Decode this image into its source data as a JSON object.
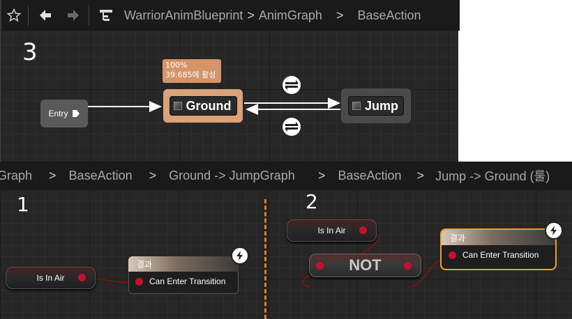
{
  "top_breadcrumb": {
    "items": [
      "WarriorAnimBlueprint",
      "AnimGraph",
      "BaseAction"
    ]
  },
  "top_graph": {
    "annotation": "3",
    "entry_label": "Entry",
    "ground_state": {
      "label": "Ground",
      "tooltip_line1": "100%",
      "tooltip_line2": "39.685에 활성"
    },
    "jump_state": {
      "label": "Jump"
    }
  },
  "bottom_breadcrumb": {
    "items": [
      "Graph",
      "BaseAction",
      "Ground -> JumpGraph",
      "BaseAction",
      "Jump -> Ground (룰)"
    ]
  },
  "bottom_left": {
    "annotation": "1",
    "is_in_air": "Is In Air",
    "result_header": "결과",
    "result_pin": "Can Enter Transition"
  },
  "bottom_right": {
    "annotation": "2",
    "is_in_air": "Is In Air",
    "not_label": "NOT",
    "result_header": "결과",
    "result_pin": "Can Enter Transition"
  },
  "colors": {
    "ground_state": "#dba27a",
    "result_highlight": "#e8a227",
    "wire_bool": "#8a1010",
    "separator": "#e07f22"
  },
  "icons": [
    "star-icon",
    "back-arrow-icon",
    "forward-arrow-icon",
    "hierarchy-icon",
    "transition-icon",
    "bolt-icon"
  ]
}
